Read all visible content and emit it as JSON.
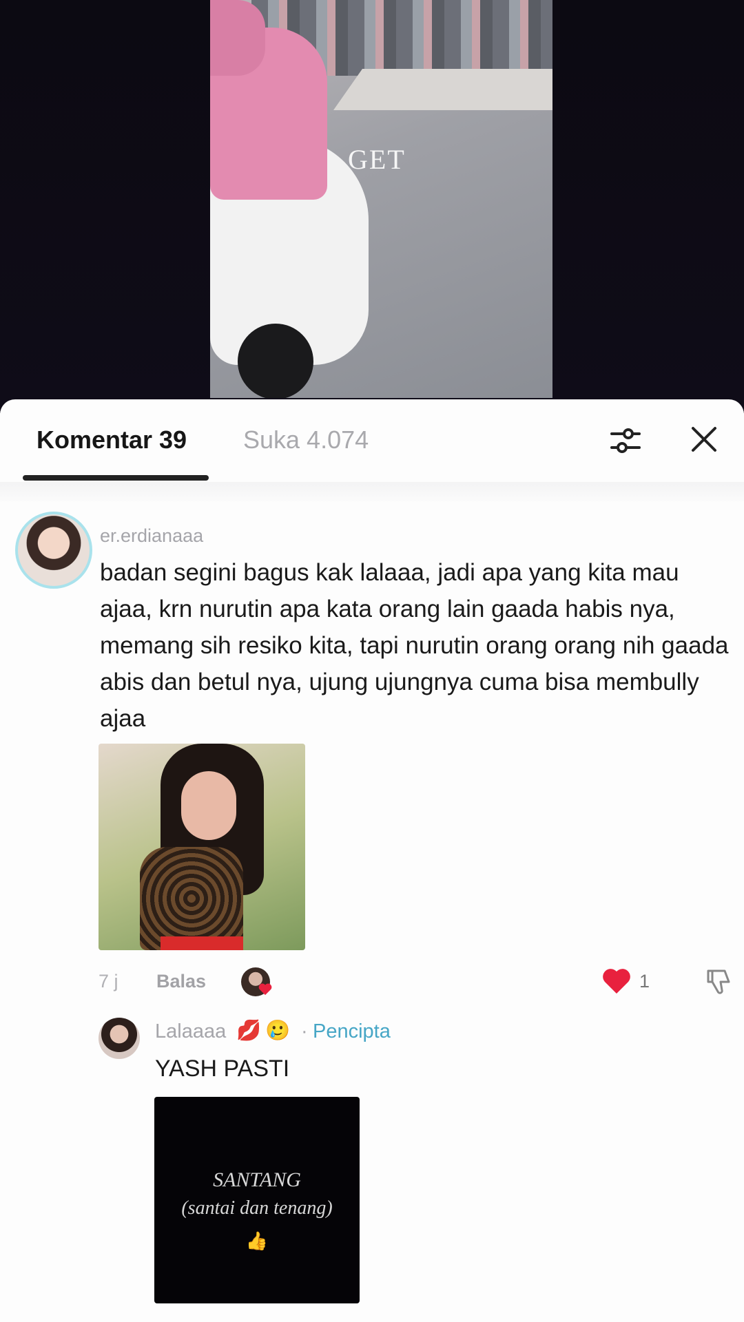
{
  "video": {
    "overlay_text": "GET"
  },
  "tabs": {
    "comments_label": "Komentar 39",
    "likes_label": "Suka 4.074"
  },
  "comment": {
    "username": "er.erdianaaa",
    "text": "badan segini bagus kak lalaaa, jadi apa yang kita mau ajaa, krn nurutin apa kata orang lain gaada habis nya, memang sih resiko kita, tapi nurutin orang orang nih gaada abis dan betul nya, ujung ujungnya cuma bisa membully ajaa",
    "time": "7 j",
    "reply_label": "Balas",
    "like_count": "1",
    "icons": [
      "heart-icon",
      "dislike-icon"
    ],
    "colors": {
      "like": "#e8213e",
      "creator": "#46a6c6",
      "avatar_ring": "#a9e2ec"
    }
  },
  "reply": {
    "username": "Lalaaaa",
    "emojis": [
      "💋",
      "🥲"
    ],
    "separator": "·",
    "creator_badge": "Pencipta",
    "text": "YASH PASTI",
    "image_line1": "SANTANG",
    "image_line2": "(santai dan tenang)",
    "image_emoji": "👍"
  }
}
